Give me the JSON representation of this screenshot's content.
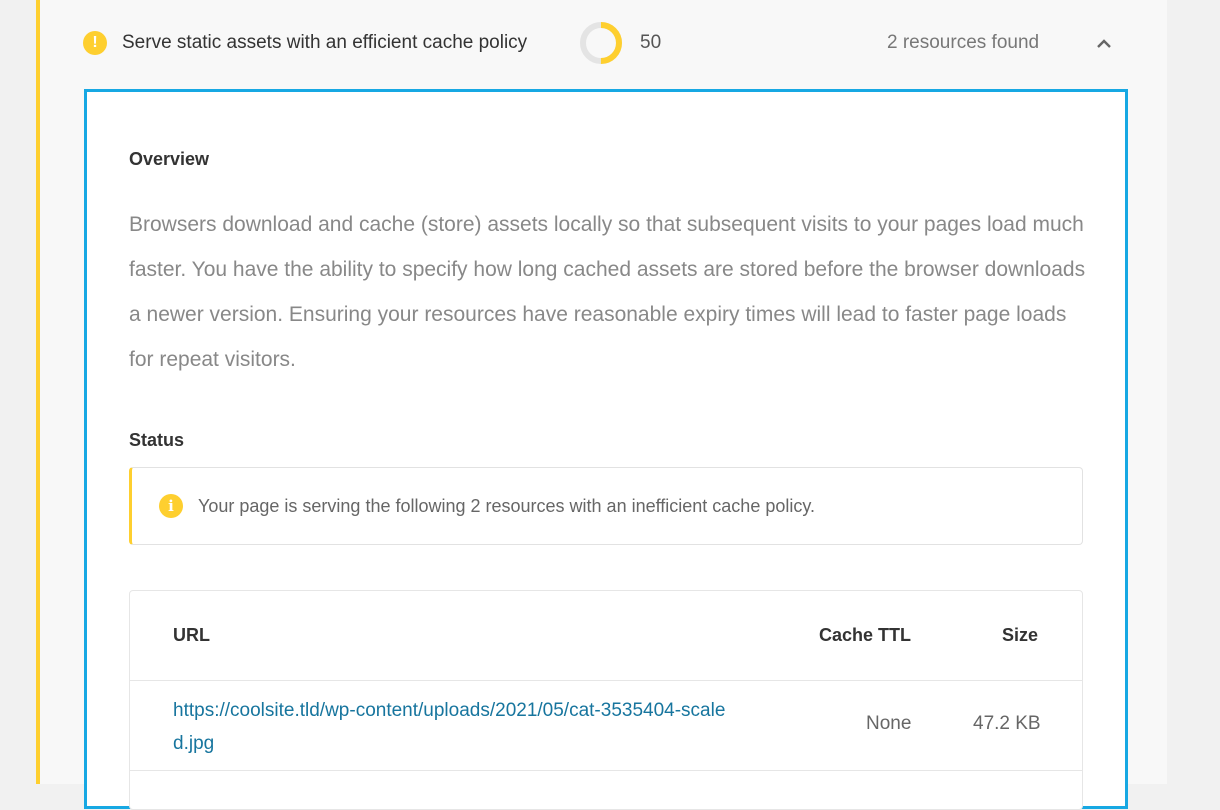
{
  "audit": {
    "title": "Serve static assets with an efficient cache policy",
    "score": "50",
    "resources_found": "2 resources found",
    "status_color": "#fecf2f",
    "accent_color": "#17a8e3",
    "score_fraction": 0.5
  },
  "overview": {
    "heading": "Overview",
    "text": "Browsers download and cache (store) assets locally so that subsequent visits to your pages load much faster. You have the ability to specify how long cached assets are stored before the browser downloads a newer version. Ensuring your resources have reasonable expiry times will lead to faster page loads for repeat visitors."
  },
  "status": {
    "heading": "Status",
    "notice": "Your page is serving the following 2 resources with an inefficient cache policy."
  },
  "table": {
    "headers": {
      "url": "URL",
      "cache_ttl": "Cache TTL",
      "size": "Size"
    },
    "rows": [
      {
        "url": "https://coolsite.tld/wp-content/uploads/2021/05/cat-3535404-scaled.jpg",
        "cache_ttl": "None",
        "size": "47.2 KB"
      }
    ]
  },
  "icons": {
    "warning": "warning-icon",
    "score": "score-ring-icon",
    "collapse": "chevron-up-icon",
    "info": "info-icon"
  }
}
